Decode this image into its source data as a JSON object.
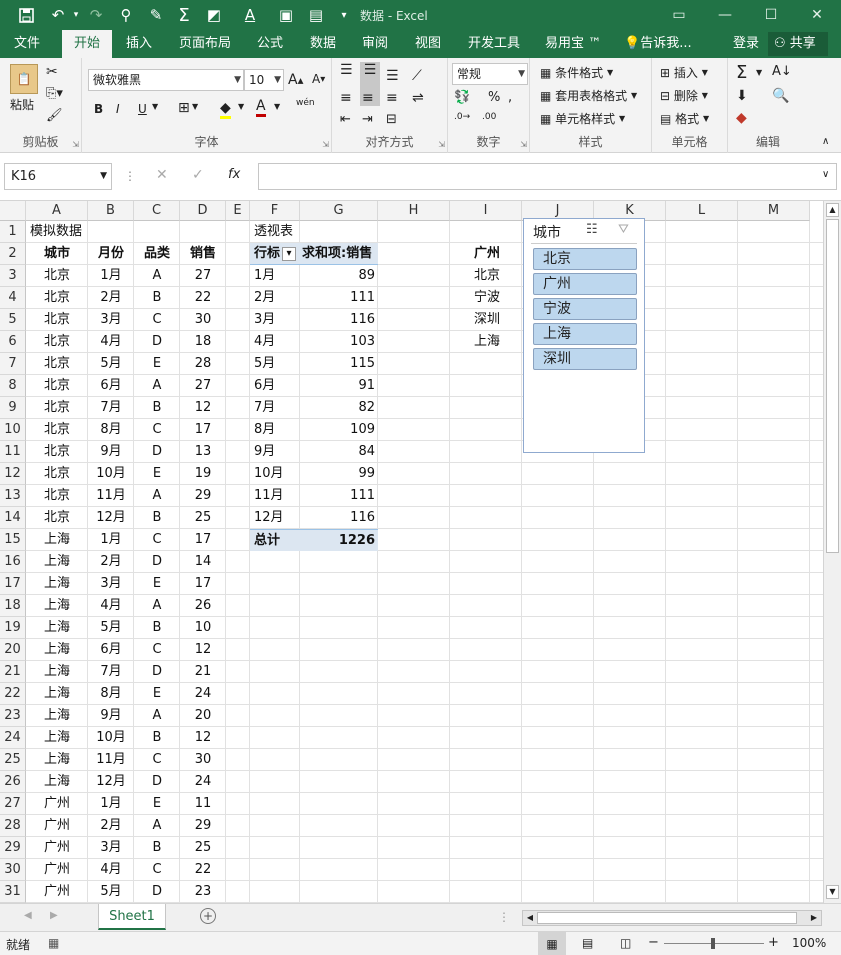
{
  "title_bar": {
    "title": "数据 - Excel"
  },
  "tabs": [
    "文件",
    "开始",
    "插入",
    "页面布局",
    "公式",
    "数据",
    "审阅",
    "视图",
    "开发工具",
    "易用宝 ™"
  ],
  "tell_me": "告诉我...",
  "login": "登录",
  "share": "共享",
  "ribbon": {
    "paste": "粘贴",
    "clipboard": "剪贴板",
    "font_name": "微软雅黑",
    "font_size": "10",
    "font_group": "字体",
    "align_group": "对齐方式",
    "number_format": "常规",
    "number_group": "数字",
    "cond_format": "条件格式",
    "table_format": "套用表格格式",
    "cell_style": "单元格样式",
    "styles_group": "样式",
    "insert": "插入",
    "delete": "删除",
    "format": "格式",
    "cells_group": "单元格",
    "edit_group": "编辑",
    "bold": "B",
    "italic": "I",
    "underline": "U",
    "phonetic": "wén",
    "percent": "%"
  },
  "formula_bar": {
    "name_box": "K16",
    "formula": ""
  },
  "columns": [
    "A",
    "B",
    "C",
    "D",
    "E",
    "F",
    "G",
    "H",
    "I",
    "J",
    "K",
    "L",
    "M"
  ],
  "rows": [
    "1",
    "2",
    "3",
    "4",
    "5",
    "6",
    "7",
    "8",
    "9",
    "10",
    "11",
    "12",
    "13",
    "14",
    "15",
    "16",
    "17",
    "18",
    "19",
    "20",
    "21",
    "22",
    "23",
    "24",
    "25",
    "26",
    "27",
    "28",
    "29",
    "30",
    "31"
  ],
  "source": {
    "title": "模拟数据",
    "headers": [
      "城市",
      "月份",
      "品类",
      "销售"
    ],
    "data": [
      [
        "北京",
        "1月",
        "A",
        "27"
      ],
      [
        "北京",
        "2月",
        "B",
        "22"
      ],
      [
        "北京",
        "3月",
        "C",
        "30"
      ],
      [
        "北京",
        "4月",
        "D",
        "18"
      ],
      [
        "北京",
        "5月",
        "E",
        "28"
      ],
      [
        "北京",
        "6月",
        "A",
        "27"
      ],
      [
        "北京",
        "7月",
        "B",
        "12"
      ],
      [
        "北京",
        "8月",
        "C",
        "17"
      ],
      [
        "北京",
        "9月",
        "D",
        "13"
      ],
      [
        "北京",
        "10月",
        "E",
        "19"
      ],
      [
        "北京",
        "11月",
        "A",
        "29"
      ],
      [
        "北京",
        "12月",
        "B",
        "25"
      ],
      [
        "上海",
        "1月",
        "C",
        "17"
      ],
      [
        "上海",
        "2月",
        "D",
        "14"
      ],
      [
        "上海",
        "3月",
        "E",
        "17"
      ],
      [
        "上海",
        "4月",
        "A",
        "26"
      ],
      [
        "上海",
        "5月",
        "B",
        "10"
      ],
      [
        "上海",
        "6月",
        "C",
        "12"
      ],
      [
        "上海",
        "7月",
        "D",
        "21"
      ],
      [
        "上海",
        "8月",
        "E",
        "24"
      ],
      [
        "上海",
        "9月",
        "A",
        "20"
      ],
      [
        "上海",
        "10月",
        "B",
        "12"
      ],
      [
        "上海",
        "11月",
        "C",
        "30"
      ],
      [
        "上海",
        "12月",
        "D",
        "24"
      ],
      [
        "广州",
        "1月",
        "E",
        "11"
      ],
      [
        "广州",
        "2月",
        "A",
        "29"
      ],
      [
        "广州",
        "3月",
        "B",
        "25"
      ],
      [
        "广州",
        "4月",
        "C",
        "22"
      ],
      [
        "广州",
        "5月",
        "D",
        "23"
      ]
    ]
  },
  "pivot": {
    "title": "透视表",
    "row_label": "行标",
    "value_label": "求和项:销售",
    "rows": [
      [
        "1月",
        "89"
      ],
      [
        "2月",
        "111"
      ],
      [
        "3月",
        "116"
      ],
      [
        "4月",
        "103"
      ],
      [
        "5月",
        "115"
      ],
      [
        "6月",
        "91"
      ],
      [
        "7月",
        "82"
      ],
      [
        "8月",
        "109"
      ],
      [
        "9月",
        "84"
      ],
      [
        "10月",
        "99"
      ],
      [
        "11月",
        "111"
      ],
      [
        "12月",
        "116"
      ]
    ],
    "total_label": "总计",
    "total": "1226"
  },
  "city_list": {
    "header": "广州",
    "items": [
      "北京",
      "宁波",
      "深圳",
      "上海"
    ]
  },
  "slicer": {
    "title": "城市",
    "items": [
      "北京",
      "广州",
      "宁波",
      "上海",
      "深圳"
    ]
  },
  "sheet_tab": "Sheet1",
  "status": {
    "ready": "就绪",
    "zoom": "100%"
  }
}
